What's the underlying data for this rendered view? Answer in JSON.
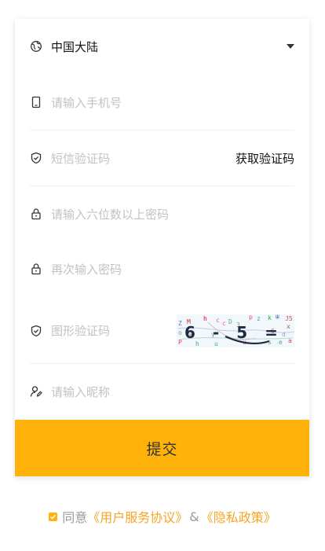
{
  "form": {
    "region": {
      "value": "中国大陆",
      "icon": "globe-icon"
    },
    "phone": {
      "placeholder": "请输入手机号",
      "icon": "phone-icon"
    },
    "sms_code": {
      "placeholder": "短信验证码",
      "icon": "shield-icon",
      "get_code_label": "获取验证码"
    },
    "password": {
      "placeholder": "请输入六位数以上密码",
      "icon": "lock-icon"
    },
    "password_confirm": {
      "placeholder": "再次输入密码",
      "icon": "lock-icon"
    },
    "image_code": {
      "placeholder": "图形验证码",
      "icon": "shield-icon",
      "captcha_text": "6-5="
    },
    "nickname": {
      "placeholder": "请输入昵称",
      "icon": "user-edit-icon"
    },
    "submit_label": "提交"
  },
  "agreement": {
    "checked": true,
    "prefix": "同意",
    "user_agreement": "《用户服务协议》",
    "amp": "&",
    "privacy_policy": "《隐私政策》"
  },
  "colors": {
    "accent": "#ffb20a",
    "link": "#f5a623",
    "placeholder": "#c2c2c2",
    "text": "#111111"
  }
}
